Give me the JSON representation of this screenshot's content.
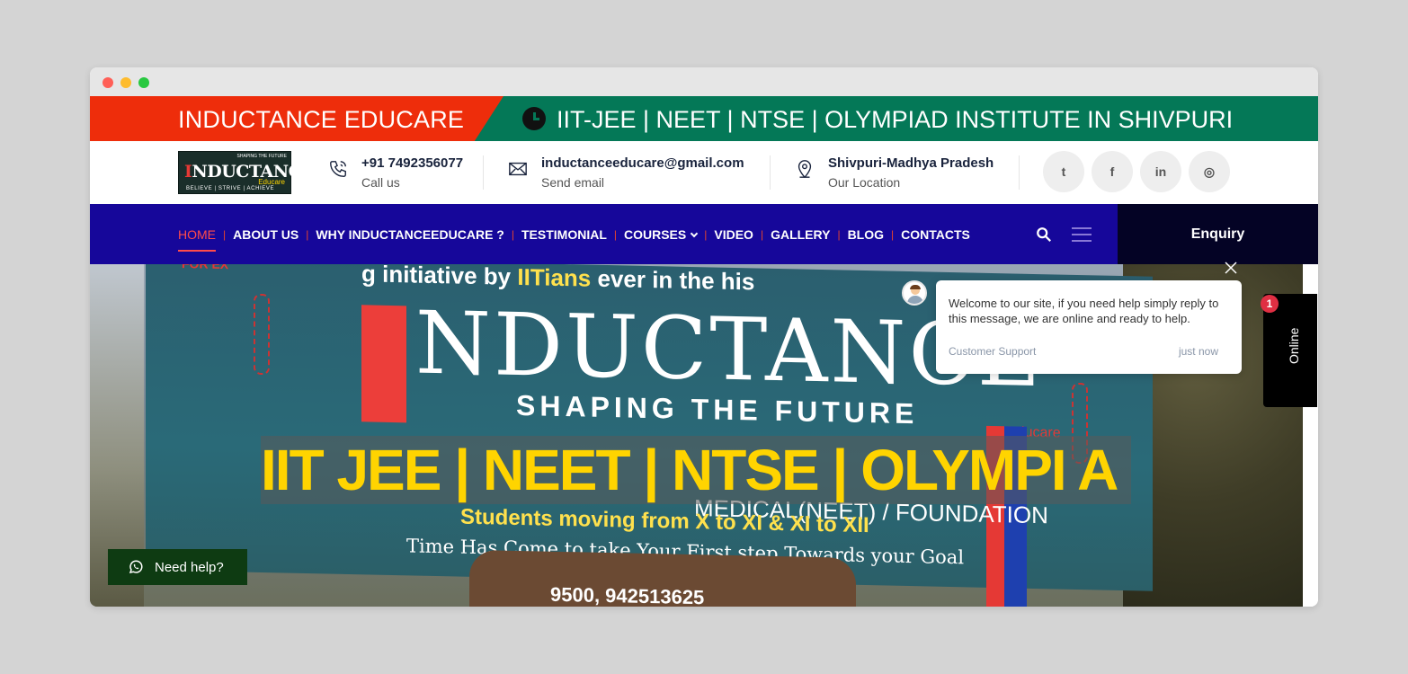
{
  "topbar": {
    "brand": "INDUCTANCE EDUCARE",
    "tagline": "IIT-JEE | NEET | NTSE | OLYMPIAD INSTITUTE IN SHIVPURI",
    "colors": {
      "left": "#ee2d0b",
      "right": "#047857"
    }
  },
  "logo": {
    "top_text": "SHAPING THE FUTURE",
    "main": "NDUCTANCE",
    "main_initial": "I",
    "sub": "Educare",
    "tagline": "BELIEVE | STRIVE | ACHIEVE"
  },
  "contact": {
    "phone": {
      "title": "+91 7492356077",
      "subtitle": "Call us",
      "icon": "phone-icon"
    },
    "email": {
      "title": "inductanceeducare@gmail.com",
      "subtitle": "Send email",
      "icon": "envelope-icon"
    },
    "location": {
      "title": "Shivpuri-Madhya Pradesh",
      "subtitle": "Our Location",
      "icon": "map-pin-icon"
    }
  },
  "social": [
    {
      "name": "twitter",
      "glyph": "t"
    },
    {
      "name": "facebook",
      "glyph": "f"
    },
    {
      "name": "linkedin",
      "glyph": "in"
    },
    {
      "name": "instagram",
      "glyph": "◎"
    }
  ],
  "nav": {
    "items": [
      "HOME",
      "ABOUT US",
      "WHY INDUCTANCEEDUCARE ?",
      "TESTIMONIAL",
      "COURSES",
      "VIDEO",
      "GALLERY",
      "BLOG",
      "CONTACTS"
    ],
    "active": "HOME",
    "enquiry": "Enquiry",
    "colors": {
      "bar": "#16079a",
      "enquiry": "#040325",
      "active": "#ff4b4b"
    }
  },
  "hero": {
    "overlay_text": "IIT JEE | NEET | NTSE | OLYMPI A",
    "billboard": {
      "forex": "FOR EX",
      "initiative_prefix": "g initiative by ",
      "initiative_highlight": "IITians",
      "initiative_suffix": " ever in the his",
      "big": "NDUCTANCE",
      "shaping": "SHAPING THE FUTURE",
      "educare": "Educare",
      "foundation": "MEDICAL(NEET) / FOUNDATION",
      "students": "Students moving from X to XI & XI to XII",
      "time": "Time Has Come to take Your First step Towards your Goal",
      "phone": "9500, 942513625"
    }
  },
  "chat": {
    "message": "Welcome to our site, if you need help simply reply to this message, we are online and ready to help.",
    "agent": "Customer Support",
    "time": "just now",
    "online_label": "Online",
    "badge_count": "1"
  },
  "need_help": {
    "label": "Need help?"
  }
}
